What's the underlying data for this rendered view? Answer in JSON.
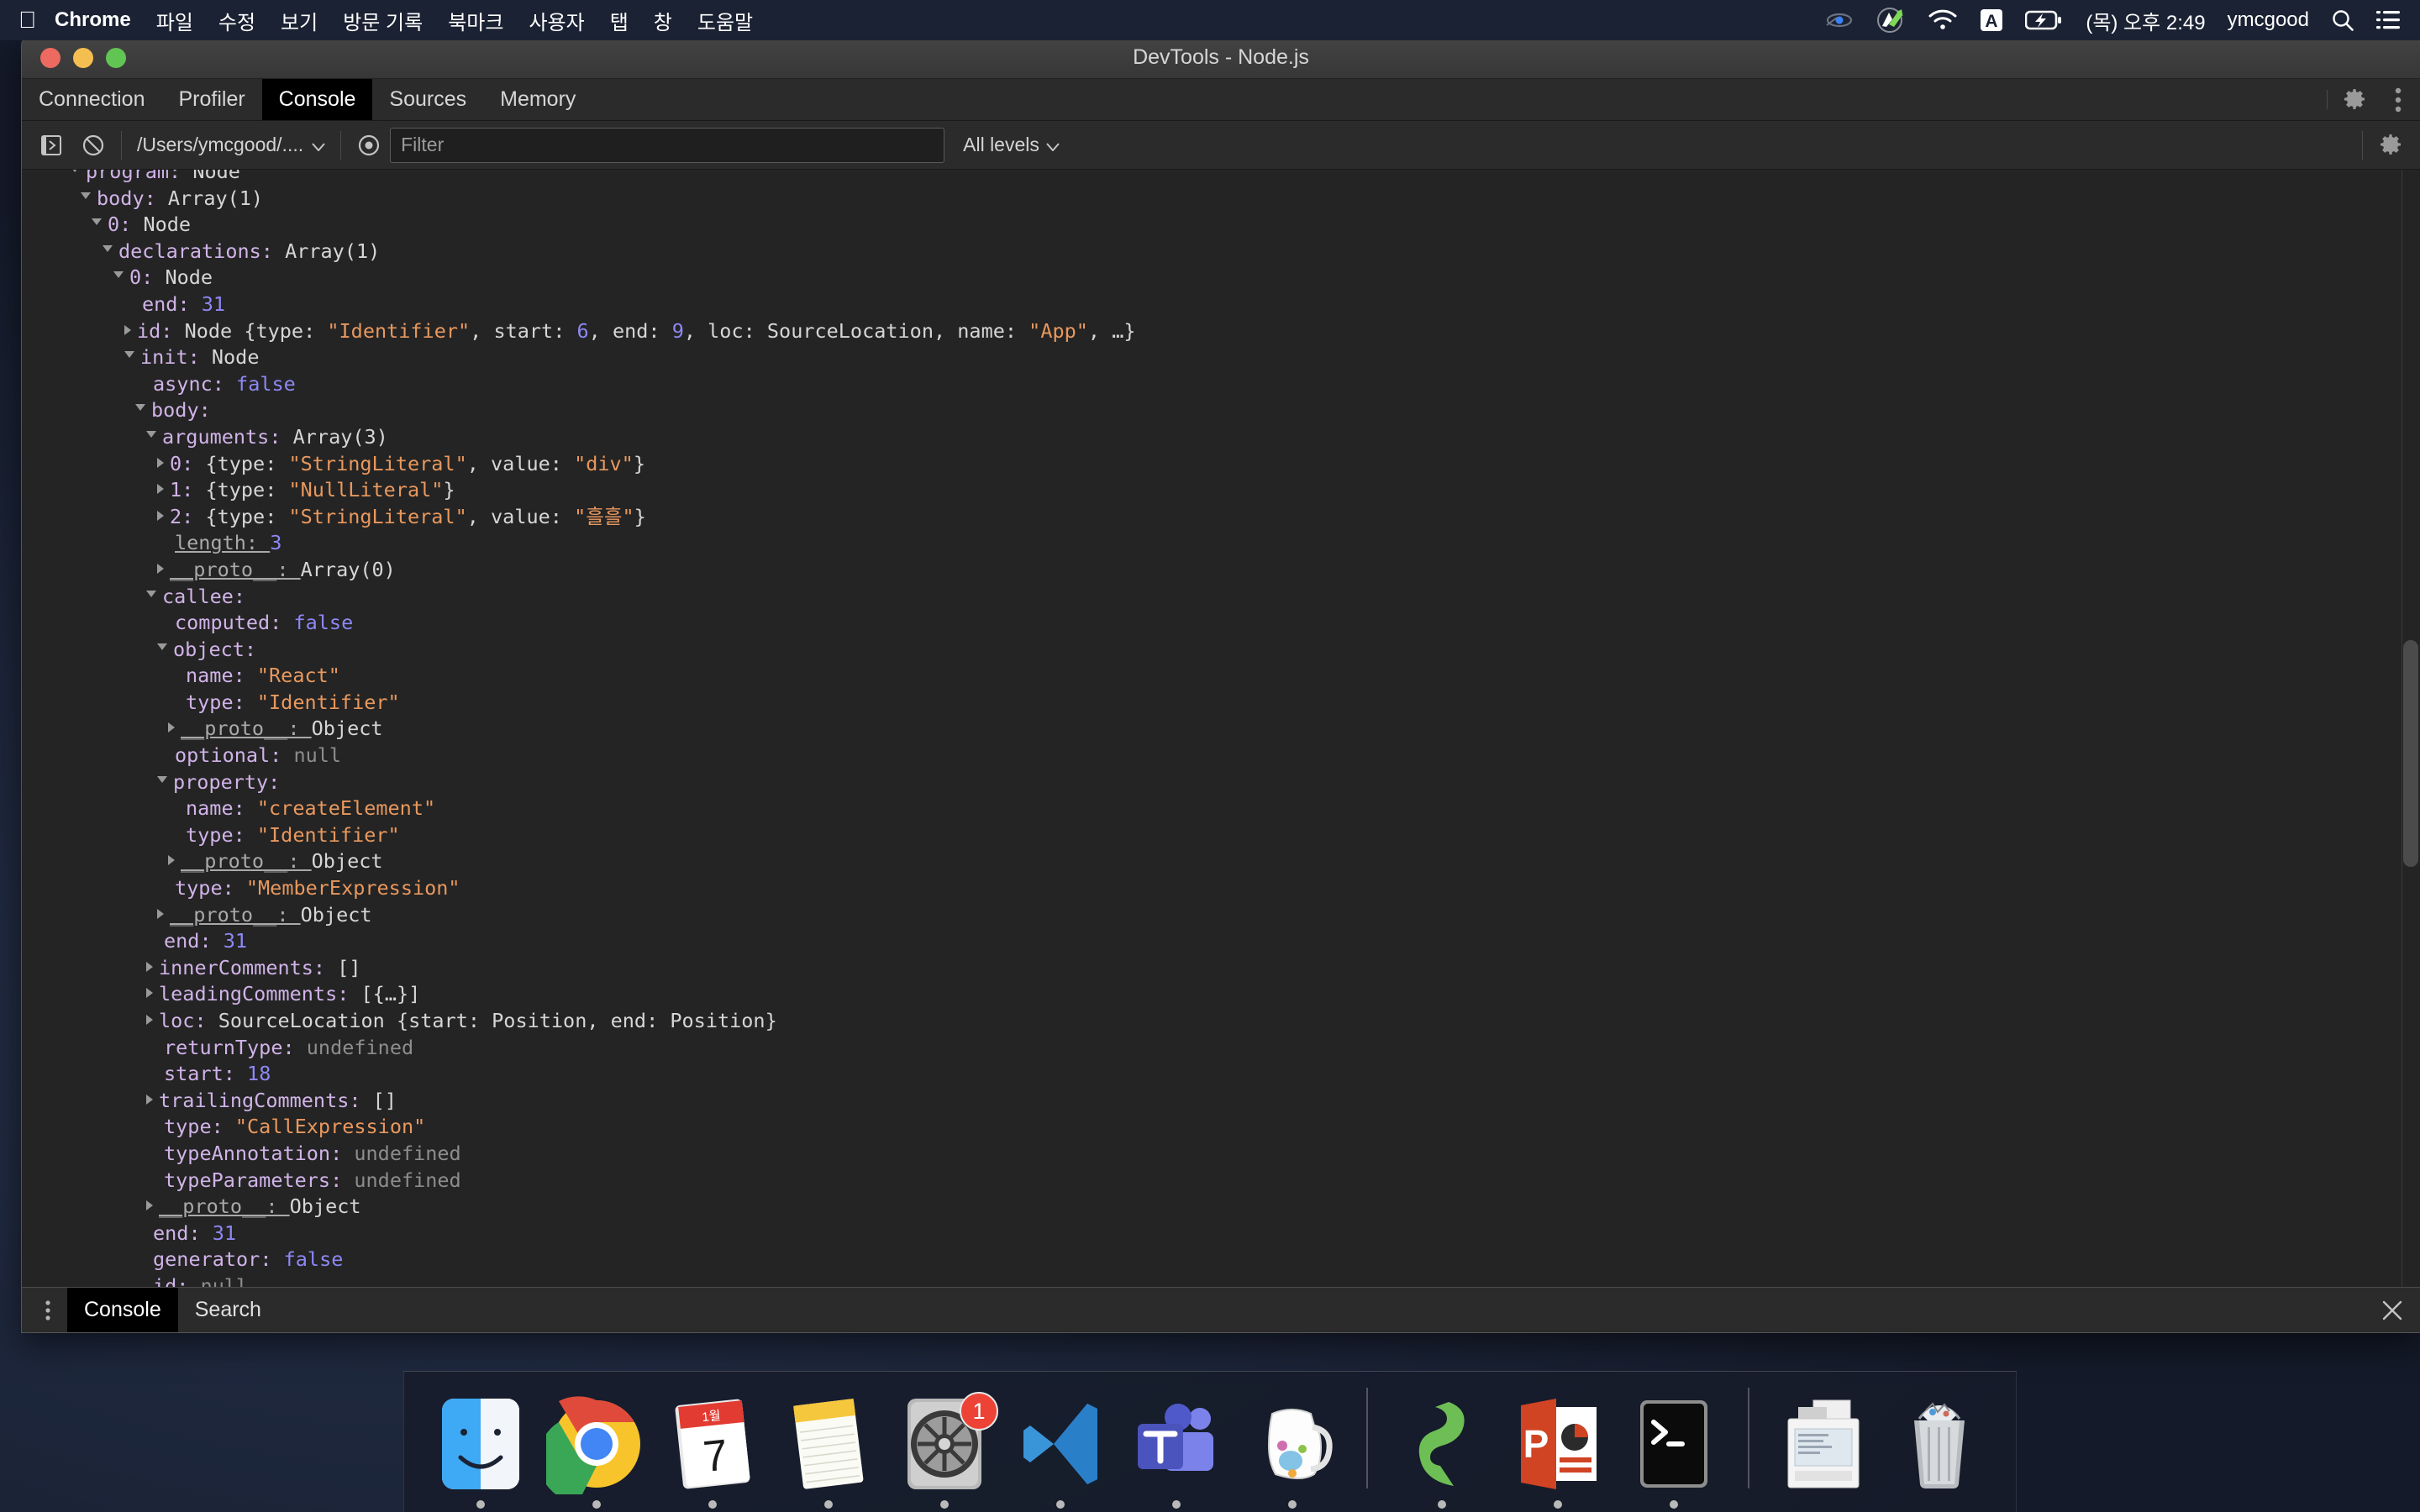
{
  "menubar": {
    "apple_icon": "apple-icon",
    "app_name": "Chrome",
    "items": [
      "파일",
      "수정",
      "보기",
      "방문 기록",
      "북마크",
      "사용자",
      "탭",
      "창",
      "도움말"
    ],
    "right": {
      "icons": [
        "eye-tracking-icon",
        "dropbox-icon",
        "wifi-icon",
        "input-source-A-icon",
        "battery-charging-icon"
      ],
      "datetime": "(목) 오후 2:49",
      "user": "ymcgood",
      "search_icon": "search-icon",
      "control_center_icon": "control-center-icon"
    }
  },
  "window": {
    "title": "DevTools - Node.js",
    "traffic_lights": [
      "close-button",
      "minimize-button",
      "zoom-button"
    ]
  },
  "tabs": {
    "items": [
      {
        "label": "Connection",
        "active": false
      },
      {
        "label": "Profiler",
        "active": false
      },
      {
        "label": "Console",
        "active": true
      },
      {
        "label": "Sources",
        "active": false
      },
      {
        "label": "Memory",
        "active": false
      }
    ],
    "settings_icon": "gear-icon",
    "more_icon": "kebab-menu-icon"
  },
  "toolbar": {
    "execute_icon": "execute-snippet-icon",
    "clear_icon": "clear-console-icon",
    "context_label": "/Users/ymcgood/....",
    "context_caret": "chevron-down-icon",
    "eye_icon": "live-expression-icon",
    "filter_placeholder": "Filter",
    "filter_value": "",
    "levels_label": "All levels",
    "levels_caret": "chevron-down-icon",
    "settings_icon": "gear-icon"
  },
  "drawer": {
    "dots_icon": "kebab-menu-icon",
    "tabs": [
      {
        "label": "Console",
        "active": true
      },
      {
        "label": "Search",
        "active": false
      }
    ],
    "close_icon": "close-icon"
  },
  "console_tree": [
    {
      "indent": 1,
      "toggle": "open",
      "segments": [
        {
          "t": "program: ",
          "c": "key"
        },
        {
          "t": "Node",
          "c": "cls"
        }
      ]
    },
    {
      "indent": 2,
      "toggle": "open",
      "segments": [
        {
          "t": "body: ",
          "c": "key"
        },
        {
          "t": "Array(1)",
          "c": "cls"
        }
      ]
    },
    {
      "indent": 3,
      "toggle": "open",
      "segments": [
        {
          "t": "0: ",
          "c": "key"
        },
        {
          "t": "Node",
          "c": "cls"
        }
      ]
    },
    {
      "indent": 4,
      "toggle": "open",
      "segments": [
        {
          "t": "declarations: ",
          "c": "key"
        },
        {
          "t": "Array(1)",
          "c": "cls"
        }
      ]
    },
    {
      "indent": 5,
      "toggle": "open",
      "segments": [
        {
          "t": "0: ",
          "c": "key"
        },
        {
          "t": "Node",
          "c": "cls"
        }
      ]
    },
    {
      "indent": 6,
      "toggle": "none",
      "segments": [
        {
          "t": "end: ",
          "c": "key"
        },
        {
          "t": "31",
          "c": "num"
        }
      ]
    },
    {
      "indent": 6,
      "toggle": "closed",
      "segments": [
        {
          "t": "id: ",
          "c": "key"
        },
        {
          "t": "Node {",
          "c": "cls"
        },
        {
          "t": "type: ",
          "c": "plain"
        },
        {
          "t": "\"Identifier\"",
          "c": "str"
        },
        {
          "t": ", start: ",
          "c": "plain"
        },
        {
          "t": "6",
          "c": "num"
        },
        {
          "t": ", end: ",
          "c": "plain"
        },
        {
          "t": "9",
          "c": "num"
        },
        {
          "t": ", loc: SourceLocation, name: ",
          "c": "plain"
        },
        {
          "t": "\"App\"",
          "c": "str"
        },
        {
          "t": ", …}",
          "c": "plain"
        }
      ]
    },
    {
      "indent": 6,
      "toggle": "open",
      "segments": [
        {
          "t": "init: ",
          "c": "key"
        },
        {
          "t": "Node",
          "c": "cls"
        }
      ]
    },
    {
      "indent": 7,
      "toggle": "none",
      "segments": [
        {
          "t": "async: ",
          "c": "key"
        },
        {
          "t": "false",
          "c": "bool"
        }
      ]
    },
    {
      "indent": 7,
      "toggle": "open",
      "segments": [
        {
          "t": "body:",
          "c": "key"
        }
      ]
    },
    {
      "indent": 8,
      "toggle": "open",
      "segments": [
        {
          "t": "arguments: ",
          "c": "key"
        },
        {
          "t": "Array(3)",
          "c": "cls"
        }
      ]
    },
    {
      "indent": 9,
      "toggle": "closed",
      "segments": [
        {
          "t": "0: ",
          "c": "key"
        },
        {
          "t": "{type: ",
          "c": "plain"
        },
        {
          "t": "\"StringLiteral\"",
          "c": "str"
        },
        {
          "t": ", value: ",
          "c": "plain"
        },
        {
          "t": "\"div\"",
          "c": "str"
        },
        {
          "t": "}",
          "c": "plain"
        }
      ]
    },
    {
      "indent": 9,
      "toggle": "closed",
      "segments": [
        {
          "t": "1: ",
          "c": "key"
        },
        {
          "t": "{type: ",
          "c": "plain"
        },
        {
          "t": "\"NullLiteral\"",
          "c": "str"
        },
        {
          "t": "}",
          "c": "plain"
        }
      ]
    },
    {
      "indent": 9,
      "toggle": "closed",
      "segments": [
        {
          "t": "2: ",
          "c": "key"
        },
        {
          "t": "{type: ",
          "c": "plain"
        },
        {
          "t": "\"StringLiteral\"",
          "c": "str"
        },
        {
          "t": ", value: ",
          "c": "plain"
        },
        {
          "t": "\"흘흘\"",
          "c": "str"
        },
        {
          "t": "}",
          "c": "plain"
        }
      ]
    },
    {
      "indent": 9,
      "toggle": "none",
      "segments": [
        {
          "t": "length: ",
          "c": "proto"
        },
        {
          "t": "3",
          "c": "num"
        }
      ]
    },
    {
      "indent": 9,
      "toggle": "closed",
      "segments": [
        {
          "t": "__proto__: ",
          "c": "proto"
        },
        {
          "t": "Array(0)",
          "c": "cls"
        }
      ]
    },
    {
      "indent": 8,
      "toggle": "open",
      "segments": [
        {
          "t": "callee:",
          "c": "key"
        }
      ]
    },
    {
      "indent": 9,
      "toggle": "none",
      "segments": [
        {
          "t": "computed: ",
          "c": "key"
        },
        {
          "t": "false",
          "c": "bool"
        }
      ]
    },
    {
      "indent": 9,
      "toggle": "open",
      "segments": [
        {
          "t": "object:",
          "c": "key"
        }
      ]
    },
    {
      "indent": 10,
      "toggle": "none",
      "segments": [
        {
          "t": "name: ",
          "c": "key"
        },
        {
          "t": "\"React\"",
          "c": "str"
        }
      ]
    },
    {
      "indent": 10,
      "toggle": "none",
      "segments": [
        {
          "t": "type: ",
          "c": "key"
        },
        {
          "t": "\"Identifier\"",
          "c": "str"
        }
      ]
    },
    {
      "indent": 10,
      "toggle": "closed",
      "segments": [
        {
          "t": "__proto__: ",
          "c": "proto"
        },
        {
          "t": "Object",
          "c": "cls"
        }
      ]
    },
    {
      "indent": 9,
      "toggle": "none",
      "segments": [
        {
          "t": "optional: ",
          "c": "key"
        },
        {
          "t": "null",
          "c": "nullv"
        }
      ]
    },
    {
      "indent": 9,
      "toggle": "open",
      "segments": [
        {
          "t": "property:",
          "c": "key"
        }
      ]
    },
    {
      "indent": 10,
      "toggle": "none",
      "segments": [
        {
          "t": "name: ",
          "c": "key"
        },
        {
          "t": "\"createElement\"",
          "c": "str"
        }
      ]
    },
    {
      "indent": 10,
      "toggle": "none",
      "segments": [
        {
          "t": "type: ",
          "c": "key"
        },
        {
          "t": "\"Identifier\"",
          "c": "str"
        }
      ]
    },
    {
      "indent": 10,
      "toggle": "closed",
      "segments": [
        {
          "t": "__proto__: ",
          "c": "proto"
        },
        {
          "t": "Object",
          "c": "cls"
        }
      ]
    },
    {
      "indent": 9,
      "toggle": "none",
      "segments": [
        {
          "t": "type: ",
          "c": "key"
        },
        {
          "t": "\"MemberExpression\"",
          "c": "str"
        }
      ]
    },
    {
      "indent": 9,
      "toggle": "closed",
      "segments": [
        {
          "t": "__proto__: ",
          "c": "proto"
        },
        {
          "t": "Object",
          "c": "cls"
        }
      ]
    },
    {
      "indent": 8,
      "toggle": "none",
      "segments": [
        {
          "t": "end: ",
          "c": "key"
        },
        {
          "t": "31",
          "c": "num"
        }
      ]
    },
    {
      "indent": 8,
      "toggle": "closed",
      "segments": [
        {
          "t": "innerComments: ",
          "c": "key"
        },
        {
          "t": "[]",
          "c": "cls"
        }
      ]
    },
    {
      "indent": 8,
      "toggle": "closed",
      "segments": [
        {
          "t": "leadingComments: ",
          "c": "key"
        },
        {
          "t": "[{…}]",
          "c": "cls"
        }
      ]
    },
    {
      "indent": 8,
      "toggle": "closed",
      "segments": [
        {
          "t": "loc: ",
          "c": "key"
        },
        {
          "t": "SourceLocation {start: Position, end: Position}",
          "c": "cls"
        }
      ]
    },
    {
      "indent": 8,
      "toggle": "none",
      "segments": [
        {
          "t": "returnType: ",
          "c": "key"
        },
        {
          "t": "undefined",
          "c": "undef"
        }
      ]
    },
    {
      "indent": 8,
      "toggle": "none",
      "segments": [
        {
          "t": "start: ",
          "c": "key"
        },
        {
          "t": "18",
          "c": "num"
        }
      ]
    },
    {
      "indent": 8,
      "toggle": "closed",
      "segments": [
        {
          "t": "trailingComments: ",
          "c": "key"
        },
        {
          "t": "[]",
          "c": "cls"
        }
      ]
    },
    {
      "indent": 8,
      "toggle": "none",
      "segments": [
        {
          "t": "type: ",
          "c": "key"
        },
        {
          "t": "\"CallExpression\"",
          "c": "str"
        }
      ]
    },
    {
      "indent": 8,
      "toggle": "none",
      "segments": [
        {
          "t": "typeAnnotation: ",
          "c": "key"
        },
        {
          "t": "undefined",
          "c": "undef"
        }
      ]
    },
    {
      "indent": 8,
      "toggle": "none",
      "segments": [
        {
          "t": "typeParameters: ",
          "c": "key"
        },
        {
          "t": "undefined",
          "c": "undef"
        }
      ]
    },
    {
      "indent": 8,
      "toggle": "closed",
      "segments": [
        {
          "t": "__proto__: ",
          "c": "proto"
        },
        {
          "t": "Object",
          "c": "cls"
        }
      ]
    },
    {
      "indent": 7,
      "toggle": "none",
      "segments": [
        {
          "t": "end: ",
          "c": "key"
        },
        {
          "t": "31",
          "c": "num"
        }
      ]
    },
    {
      "indent": 7,
      "toggle": "none",
      "segments": [
        {
          "t": "generator: ",
          "c": "key"
        },
        {
          "t": "false",
          "c": "bool"
        }
      ]
    },
    {
      "indent": 7,
      "toggle": "none",
      "segments": [
        {
          "t": "id: ",
          "c": "key"
        },
        {
          "t": "null",
          "c": "nullv"
        }
      ]
    }
  ],
  "dock": {
    "items": [
      {
        "name": "finder",
        "running": true
      },
      {
        "name": "google-chrome",
        "running": true
      },
      {
        "name": "calendar",
        "running": true,
        "month": "1월",
        "day": "7"
      },
      {
        "name": "notes",
        "running": true
      },
      {
        "name": "system-preferences",
        "running": true,
        "badge": "1"
      },
      {
        "name": "visual-studio-code",
        "running": true
      },
      {
        "name": "microsoft-teams",
        "running": true
      },
      {
        "name": "jitsi-meet",
        "running": true
      },
      {
        "separator": true
      },
      {
        "name": "postman",
        "running": true
      },
      {
        "name": "microsoft-powerpoint",
        "running": true
      },
      {
        "name": "terminal",
        "running": true
      },
      {
        "separator": true
      },
      {
        "name": "documents-stack",
        "running": false
      },
      {
        "name": "trash",
        "running": false
      }
    ]
  }
}
